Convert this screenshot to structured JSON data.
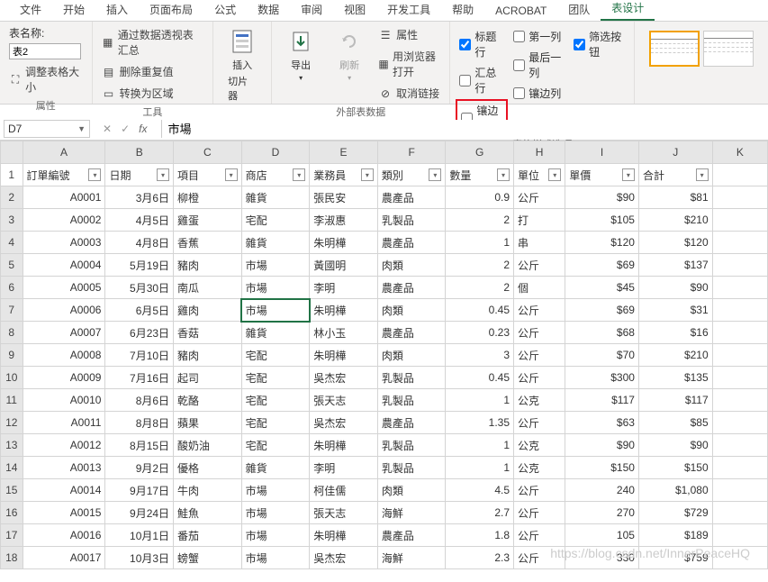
{
  "tabs": [
    "文件",
    "开始",
    "插入",
    "页面布局",
    "公式",
    "数据",
    "审阅",
    "视图",
    "开发工具",
    "帮助",
    "ACROBAT",
    "团队",
    "表设计"
  ],
  "active_tab_index": 12,
  "ribbon": {
    "props": {
      "name_label": "表名称:",
      "name_value": "表2",
      "resize": "调整表格大小",
      "group": "属性"
    },
    "tools": {
      "pivot": "通过数据透视表汇总",
      "dedup": "删除重复值",
      "torange": "转换为区域",
      "group": "工具"
    },
    "slicer": {
      "insert": "插入",
      "sub": "切片器"
    },
    "ext": {
      "export": "导出",
      "refresh": "刷新",
      "props": "属性",
      "browser": "用浏览器打开",
      "unlink": "取消链接",
      "group": "外部表数据"
    },
    "style_opts": {
      "header_row": "标题行",
      "first_col": "第一列",
      "filter_btn": "筛选按钮",
      "total_row": "汇总行",
      "last_col": "最后一列",
      "banded_row": "镶边行",
      "banded_col": "镶边列",
      "group": "表格样式选项"
    }
  },
  "formula": {
    "cell_ref": "D7",
    "fx": "fx",
    "value": "市場"
  },
  "columns": [
    "A",
    "B",
    "C",
    "D",
    "E",
    "F",
    "G",
    "H",
    "I",
    "J",
    "K"
  ],
  "headers": [
    "訂單編號",
    "日期",
    "項目",
    "商店",
    "業務員",
    "類別",
    "數量",
    "單位",
    "單價",
    "合計"
  ],
  "rows": [
    {
      "n": 2,
      "a": "A0001",
      "b": "3月6日",
      "c": "柳橙",
      "d": "雜貨",
      "e": "張民安",
      "f": "農產品",
      "g": "0.9",
      "h": "公斤",
      "i": "$90",
      "j": "$81"
    },
    {
      "n": 3,
      "a": "A0002",
      "b": "4月5日",
      "c": "雞蛋",
      "d": "宅配",
      "e": "李淑惠",
      "f": "乳製品",
      "g": "2",
      "h": "打",
      "i": "$105",
      "j": "$210"
    },
    {
      "n": 4,
      "a": "A0003",
      "b": "4月8日",
      "c": "香蕉",
      "d": "雜貨",
      "e": "朱明樺",
      "f": "農產品",
      "g": "1",
      "h": "串",
      "i": "$120",
      "j": "$120"
    },
    {
      "n": 5,
      "a": "A0004",
      "b": "5月19日",
      "c": "豬肉",
      "d": "市場",
      "e": "黃國明",
      "f": "肉類",
      "g": "2",
      "h": "公斤",
      "i": "$69",
      "j": "$137"
    },
    {
      "n": 6,
      "a": "A0005",
      "b": "5月30日",
      "c": "南瓜",
      "d": "市場",
      "e": "李明",
      "f": "農產品",
      "g": "2",
      "h": "個",
      "i": "$45",
      "j": "$90"
    },
    {
      "n": 7,
      "a": "A0006",
      "b": "6月5日",
      "c": "雞肉",
      "d": "市場",
      "e": "朱明樺",
      "f": "肉類",
      "g": "0.45",
      "h": "公斤",
      "i": "$69",
      "j": "$31"
    },
    {
      "n": 8,
      "a": "A0007",
      "b": "6月23日",
      "c": "香菇",
      "d": "雜貨",
      "e": "林小玉",
      "f": "農產品",
      "g": "0.23",
      "h": "公斤",
      "i": "$68",
      "j": "$16"
    },
    {
      "n": 9,
      "a": "A0008",
      "b": "7月10日",
      "c": "豬肉",
      "d": "宅配",
      "e": "朱明樺",
      "f": "肉類",
      "g": "3",
      "h": "公斤",
      "i": "$70",
      "j": "$210"
    },
    {
      "n": 10,
      "a": "A0009",
      "b": "7月16日",
      "c": "起司",
      "d": "宅配",
      "e": "吳杰宏",
      "f": "乳製品",
      "g": "0.45",
      "h": "公斤",
      "i": "$300",
      "j": "$135"
    },
    {
      "n": 11,
      "a": "A0010",
      "b": "8月6日",
      "c": "乾酪",
      "d": "宅配",
      "e": "張天志",
      "f": "乳製品",
      "g": "1",
      "h": "公克",
      "i": "$117",
      "j": "$117"
    },
    {
      "n": 12,
      "a": "A0011",
      "b": "8月8日",
      "c": "蘋果",
      "d": "宅配",
      "e": "吳杰宏",
      "f": "農產品",
      "g": "1.35",
      "h": "公斤",
      "i": "$63",
      "j": "$85"
    },
    {
      "n": 13,
      "a": "A0012",
      "b": "8月15日",
      "c": "酸奶油",
      "d": "宅配",
      "e": "朱明樺",
      "f": "乳製品",
      "g": "1",
      "h": "公克",
      "i": "$90",
      "j": "$90"
    },
    {
      "n": 14,
      "a": "A0013",
      "b": "9月2日",
      "c": "優格",
      "d": "雜貨",
      "e": "李明",
      "f": "乳製品",
      "g": "1",
      "h": "公克",
      "i": "$150",
      "j": "$150"
    },
    {
      "n": 15,
      "a": "A0014",
      "b": "9月17日",
      "c": "牛肉",
      "d": "市場",
      "e": "柯佳儒",
      "f": "肉類",
      "g": "4.5",
      "h": "公斤",
      "i": "240",
      "j": "$1,080"
    },
    {
      "n": 16,
      "a": "A0015",
      "b": "9月24日",
      "c": "鮭魚",
      "d": "市場",
      "e": "張天志",
      "f": "海鮮",
      "g": "2.7",
      "h": "公斤",
      "i": "270",
      "j": "$729"
    },
    {
      "n": 17,
      "a": "A0016",
      "b": "10月1日",
      "c": "番茄",
      "d": "市場",
      "e": "朱明樺",
      "f": "農產品",
      "g": "1.8",
      "h": "公斤",
      "i": "105",
      "j": "$189"
    },
    {
      "n": 18,
      "a": "A0017",
      "b": "10月3日",
      "c": "螃蟹",
      "d": "市場",
      "e": "吳杰宏",
      "f": "海鮮",
      "g": "2.3",
      "h": "公斤",
      "i": "330",
      "j": "$759"
    }
  ],
  "selected_cell": "D7",
  "watermark": "https://blog.csdn.net/InnerPeaceHQ"
}
